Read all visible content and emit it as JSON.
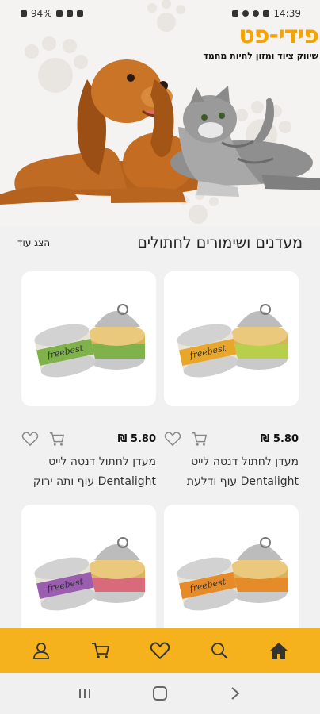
{
  "status_bar": {
    "battery": "94%",
    "time": "14:39"
  },
  "brand": {
    "name": "פידי-פט",
    "tagline": "שיווק ציוד ומזון לחיות מחמד"
  },
  "section": {
    "title": "מעדנים ושימורים לחתולים",
    "show_more": "הצג עוד"
  },
  "products": [
    {
      "price": "5.80 ₪",
      "name_line1": "מעדן לחתול דנטה לייט",
      "name_line2": "Dentalight עוף ודלעת",
      "accent": "#e8a62a"
    },
    {
      "price": "5.80 ₪",
      "name_line1": "מעדן לחתול דנטה לייט",
      "name_line2": "Dentalight עוף ותה ירוק",
      "accent": "#7fb24a"
    },
    {
      "price": "",
      "name_line1": "",
      "name_line2": "",
      "accent": "#e58b2a"
    },
    {
      "price": "",
      "name_line1": "",
      "name_line2": "",
      "accent": "#9a5db0"
    }
  ],
  "icons": {
    "wishlist": "heart-icon",
    "cart": "cart-icon",
    "nav": [
      "user-icon",
      "cart-icon",
      "heart-icon",
      "search-icon",
      "home-icon"
    ]
  },
  "colors": {
    "brand_orange": "#f5a300",
    "nav_bar": "#f6b21c"
  }
}
